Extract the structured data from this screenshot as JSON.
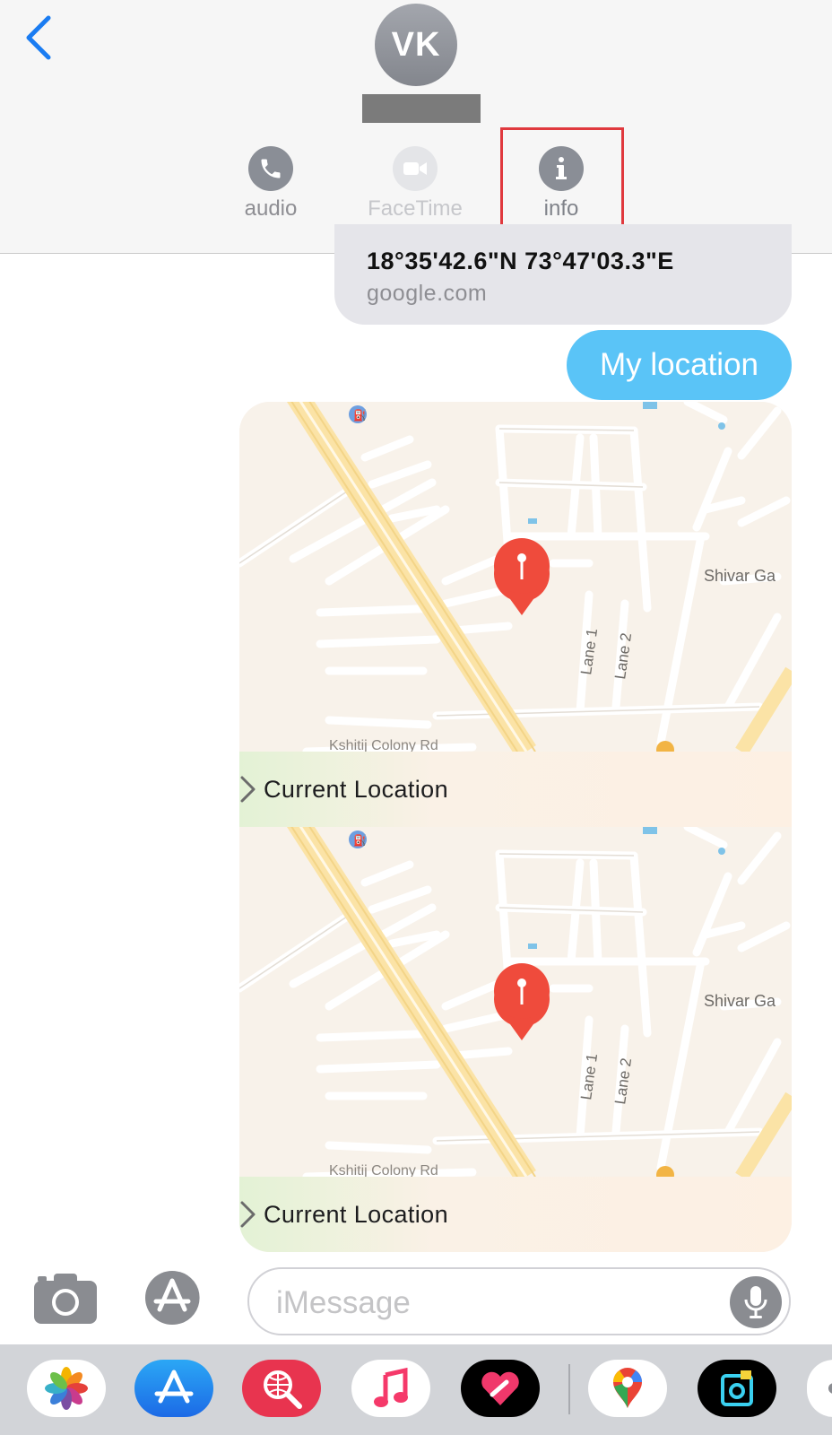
{
  "header": {
    "avatar_initials": "VK",
    "actions": [
      {
        "label": "audio",
        "icon": "phone-icon",
        "enabled": true
      },
      {
        "label": "FaceTime",
        "icon": "video-camera-icon",
        "enabled": false
      },
      {
        "label": "info",
        "icon": "info-icon",
        "enabled": true,
        "highlighted": true
      }
    ],
    "highlight_color": "#e0393e"
  },
  "messages": {
    "link_preview": {
      "title": "18°35'42.6\"N 73°47'03.3\"E",
      "domain": "google.com"
    },
    "text_message": "My location",
    "bubble_color": "#5ac4f7",
    "location_cards": [
      {
        "footer_label": "Current Location",
        "map_labels": {
          "area": "Shivar Ga",
          "lane1": "Lane 1",
          "lane2": "Lane 2",
          "road": "Kshitij Colony Rd"
        }
      },
      {
        "footer_label": "Current Location",
        "map_labels": {
          "area": "Shivar Ga",
          "lane1": "Lane 1",
          "lane2": "Lane 2",
          "road": "Kshitij Colony Rd"
        }
      }
    ]
  },
  "composer": {
    "placeholder": "iMessage",
    "value": ""
  },
  "app_strip": [
    {
      "name": "photos-app-icon"
    },
    {
      "name": "app-store-icon"
    },
    {
      "name": "image-search-app-icon"
    },
    {
      "name": "music-app-icon"
    },
    {
      "name": "digital-touch-icon"
    },
    {
      "name": "google-maps-icon"
    },
    {
      "name": "camera-app-icon"
    }
  ]
}
